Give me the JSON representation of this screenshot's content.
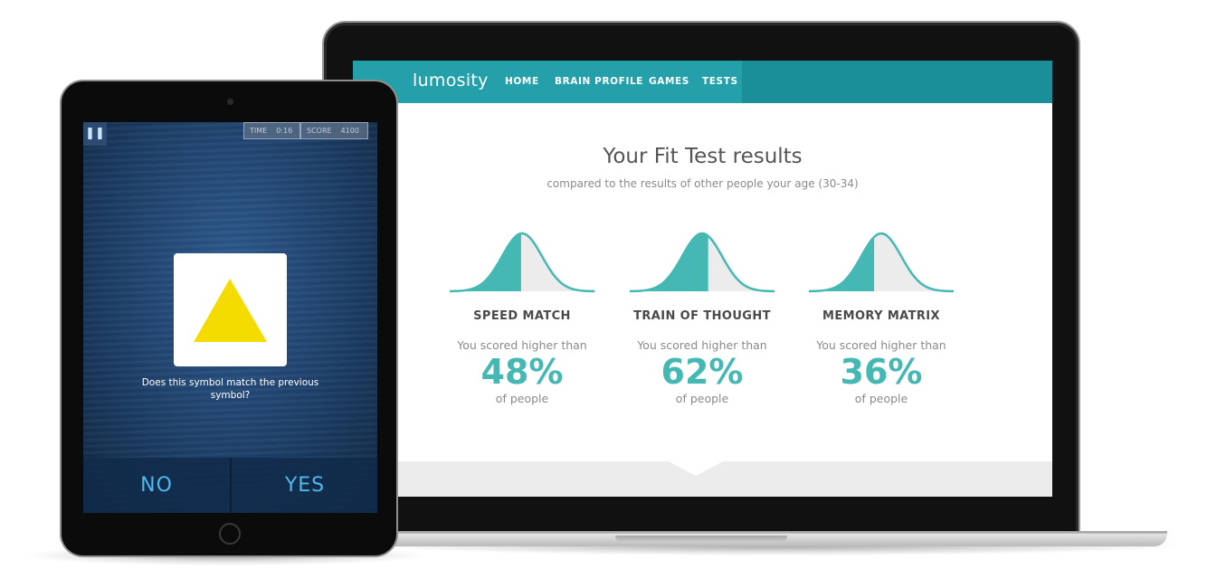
{
  "laptop": {
    "nav": {
      "logo": "lumosity",
      "items": [
        "HOME",
        "BRAIN PROFILE",
        "GAMES",
        "TESTS"
      ]
    },
    "results": {
      "title": "Your Fit Test results",
      "subtitle": "compared to the results of other people your age (30-34)",
      "line1": "You scored higher than",
      "line2": "of people",
      "games": [
        {
          "name": "SPEED MATCH",
          "percent": "48%",
          "percentile": 48
        },
        {
          "name": "TRAIN OF THOUGHT",
          "percent": "62%",
          "percentile": 62
        },
        {
          "name": "MEMORY MATRIX",
          "percent": "36%",
          "percentile": 36
        }
      ]
    },
    "colors": {
      "nav": "#1a8f99",
      "accent": "#45b8b4"
    }
  },
  "tablet": {
    "pause_icon": "pause-icon",
    "hud": {
      "time_label": "TIME",
      "time_value": "0:16",
      "score_label": "SCORE",
      "score_value": "4100"
    },
    "symbol": {
      "shape": "triangle",
      "color": "#f5dc00"
    },
    "question": "Does this symbol match the previous symbol?",
    "buttons": {
      "no": "NO",
      "yes": "YES"
    }
  }
}
